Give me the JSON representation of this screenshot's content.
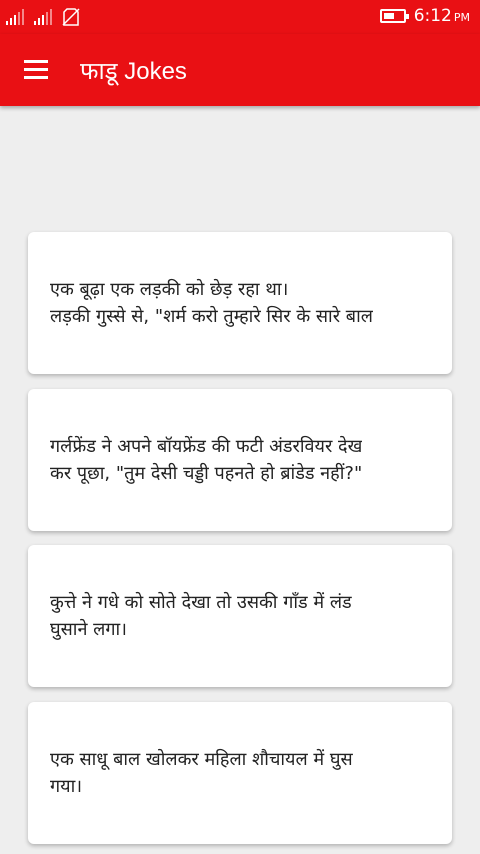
{
  "status_bar": {
    "time": "6:12",
    "am_pm": "PM",
    "battery_level": 0.6,
    "signal_icons": [
      "signal-1-icon",
      "signal-2-icon",
      "no-sim-icon"
    ]
  },
  "app_bar": {
    "title": "फाडू Jokes",
    "menu_icon": "hamburger-menu-icon",
    "color": "#e91014"
  },
  "jokes": [
    "एक बूढ़ा एक लड़की को छेड़ रहा था।\nलड़की गुस्से से, \"शर्म करो तुम्हारे सिर के सारे बाल",
    "गर्लफ्रेंड ने अपने बॉयफ्रेंड की फटी अंडरवियर देख\nकर पूछा, \"तुम देसी चड्डी पहनते हो ब्रांडेड नहीं?\"",
    "कुत्ते ने गधे को सोते देखा तो उसकी गाँड में लंड\nघुसाने लगा।",
    "एक साधू बाल खोलकर महिला शौचायल में घुस\nगया।"
  ]
}
